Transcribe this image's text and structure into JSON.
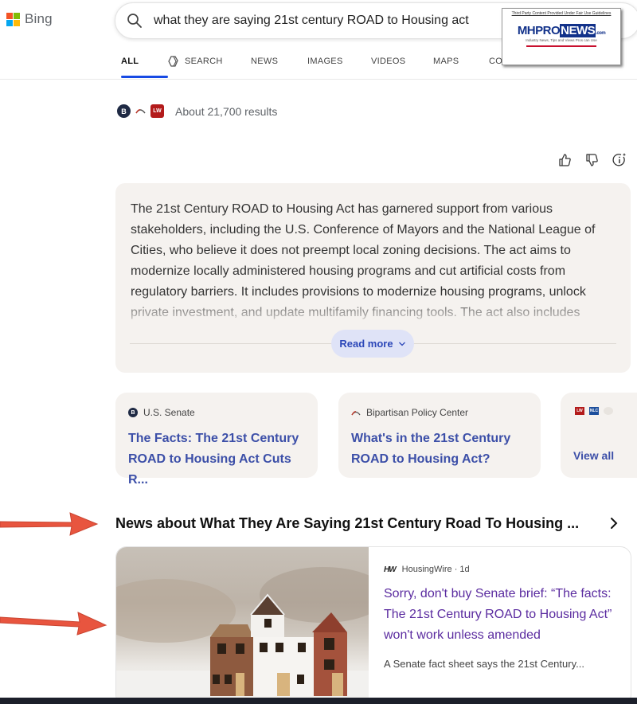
{
  "brand": {
    "name": "Bing",
    "colors": [
      "#f35325",
      "#81bc06",
      "#05a6f0",
      "#ffba08"
    ]
  },
  "search": {
    "query": "what they are saying 21st century ROAD to Housing act",
    "icon": "search-icon"
  },
  "watermark": {
    "top": "Third Party Content Provided Under Fair Use Guidelines",
    "left": "MHPRO",
    "mid": "NEWS",
    "suffix": ".com",
    "tagline": "Industry News, Tips and Views Pros can Use"
  },
  "tabs": [
    {
      "label": "ALL",
      "active": true
    },
    {
      "label": "SEARCH",
      "icon": "copilot-icon"
    },
    {
      "label": "NEWS"
    },
    {
      "label": "IMAGES"
    },
    {
      "label": "VIDEOS"
    },
    {
      "label": "MAPS"
    },
    {
      "label": "CO"
    }
  ],
  "results": {
    "count_text": "About 21,700 results",
    "source_icons": [
      "B",
      "",
      "LW"
    ]
  },
  "feedback": {
    "icons": [
      "thumbs-up-icon",
      "thumbs-down-icon",
      "info-sparkle-icon"
    ]
  },
  "answer": {
    "text": "The 21st Century ROAD to Housing Act has garnered support from various stakeholders, including the U.S. Conference of Mayors and the National League of Cities, who believe it does not preempt local zoning decisions. The act aims to modernize locally administered housing programs and cut artificial costs from regulatory barriers. It includes provisions to modernize housing programs, unlock private investment, and update multifamily financing tools. The act also includes",
    "read_more": "Read more"
  },
  "sources": [
    {
      "site": "U.S. Senate",
      "icon": "B",
      "title": "The Facts: The 21st Century ROAD to Housing Act Cuts R..."
    },
    {
      "site": "Bipartisan Policy Center",
      "icon": "",
      "title": "What's in the 21st Century ROAD to Housing Act?"
    }
  ],
  "view_all": {
    "label": "View all",
    "icons": [
      "LW",
      "NLC",
      ""
    ]
  },
  "news": {
    "heading": "News about What They Are Saying 21st Century Road To Housing ...",
    "card": {
      "source_logo": "HW",
      "source": "HousingWire · 1d",
      "title": "Sorry, don't buy Senate brief: “The facts: The 21st Century ROAD to Housing Act” won't work unless amended",
      "snippet": "A Senate fact sheet says the 21st Century..."
    }
  },
  "annotation_color": "#e8553f"
}
